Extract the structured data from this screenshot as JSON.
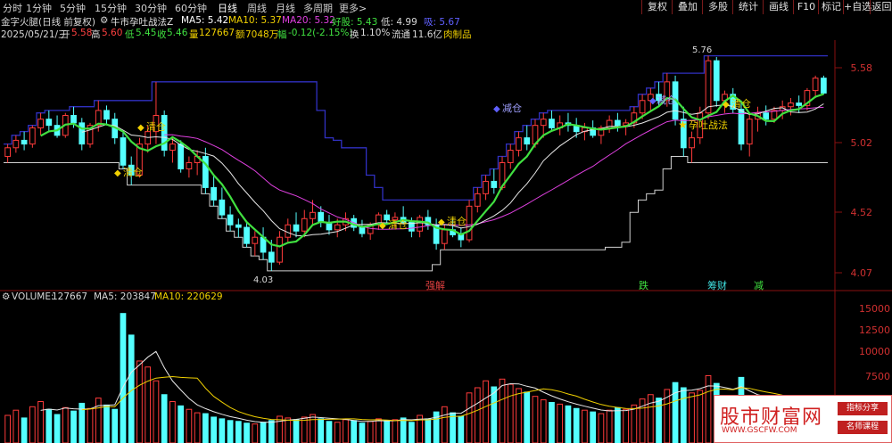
{
  "toolbar": {
    "periods": [
      "分时",
      "1分钟",
      "5分钟",
      "15分钟",
      "30分钟",
      "60分钟",
      "日线",
      "周线",
      "月线",
      "多周期",
      "更多>"
    ],
    "active_period": "日线",
    "buttons": [
      "复权",
      "叠加",
      "多股",
      "统计",
      "画线",
      "F10",
      "标记",
      "+自选",
      "返回"
    ]
  },
  "info": {
    "name": "金字火腿(日线 前复权)",
    "indicator": "牛市孕吐战法Z",
    "ma5": "MA5: 5.42",
    "ma10": "MA10: 5.37",
    "ma20": "MA20: 5.32",
    "haogu": "好股: 5.43",
    "di": "低: 4.99",
    "extra": "吸: 5.67",
    "date": "2025/05/21/三",
    "open_label": "开",
    "open": "5.58",
    "high_label": "高",
    "high": "5.60",
    "low_label": "低",
    "low": "5.45",
    "close_label": "收",
    "close": "5.46",
    "vol_label": "量",
    "vol": "127667",
    "amount_label": "额",
    "amount": "7048万",
    "change_label": "幅",
    "change": "-0.12(-2.15%)",
    "turnover_label": "换",
    "turnover": "1.10%",
    "float_label": "流通",
    "float": "11.6亿",
    "sector": "肉制品"
  },
  "price_axis": [
    "5.58",
    "5.02",
    "4.52",
    "4.07"
  ],
  "vol_axis": [
    "15000",
    "12500",
    "10000",
    "7500"
  ],
  "annotations": {
    "high_label": "5.76",
    "low_label": "4.03",
    "signals": [
      "清仓",
      "清仓",
      "清仓",
      "清仓",
      "减仓",
      "减仓",
      "清仓"
    ],
    "combo": "孕吐战法",
    "bottom_tags": [
      "强解",
      "跌",
      "筹财",
      "减"
    ]
  },
  "volume_bar": {
    "label": "VOLUME:",
    "value": "127667",
    "ma5": "MA5: 203847",
    "ma10": "MA10: 220629"
  },
  "watermark": {
    "title": "股市财富网",
    "url": "WWW.GSCFW.COM",
    "tag1": "指标分享",
    "tag2": "名师课程"
  },
  "chart_data": {
    "type": "candlestick",
    "price_ylim": [
      3.9,
      5.85
    ],
    "volume_ylim": [
      0,
      16000
    ],
    "candles": [
      [
        4.95,
        5.05,
        4.9,
        5.02
      ],
      [
        5.02,
        5.12,
        4.98,
        5.08
      ],
      [
        5.08,
        5.15,
        5.0,
        5.05
      ],
      [
        5.05,
        5.2,
        5.02,
        5.18
      ],
      [
        5.18,
        5.3,
        5.12,
        5.25
      ],
      [
        5.25,
        5.32,
        5.15,
        5.2
      ],
      [
        5.2,
        5.28,
        5.1,
        5.12
      ],
      [
        5.12,
        5.3,
        5.1,
        5.28
      ],
      [
        5.28,
        5.35,
        5.18,
        5.22
      ],
      [
        5.22,
        5.26,
        5.0,
        5.05
      ],
      [
        5.05,
        5.22,
        5.02,
        5.2
      ],
      [
        5.2,
        5.4,
        5.15,
        5.32
      ],
      [
        5.32,
        5.36,
        5.2,
        5.25
      ],
      [
        5.25,
        5.3,
        5.05,
        5.1
      ],
      [
        5.1,
        5.15,
        4.85,
        4.88
      ],
      [
        4.88,
        4.95,
        4.72,
        4.8
      ],
      [
        4.8,
        5.1,
        4.78,
        5.05
      ],
      [
        5.05,
        5.2,
        4.98,
        5.15
      ],
      [
        5.15,
        5.55,
        5.05,
        5.28
      ],
      [
        5.28,
        5.32,
        4.95,
        5.0
      ],
      [
        5.0,
        5.1,
        4.9,
        5.05
      ],
      [
        5.05,
        5.08,
        4.82,
        4.85
      ],
      [
        4.85,
        4.95,
        4.78,
        4.9
      ],
      [
        4.9,
        5.0,
        4.8,
        4.95
      ],
      [
        4.95,
        5.02,
        4.65,
        4.7
      ],
      [
        4.7,
        4.8,
        4.55,
        4.6
      ],
      [
        4.6,
        4.7,
        4.45,
        4.48
      ],
      [
        4.48,
        4.55,
        4.35,
        4.4
      ],
      [
        4.4,
        4.45,
        4.3,
        4.38
      ],
      [
        4.38,
        4.42,
        4.22,
        4.25
      ],
      [
        4.25,
        4.35,
        4.15,
        4.3
      ],
      [
        4.3,
        4.38,
        4.12,
        4.18
      ],
      [
        4.18,
        4.28,
        4.03,
        4.1
      ],
      [
        4.1,
        4.35,
        4.08,
        4.3
      ],
      [
        4.3,
        4.45,
        4.25,
        4.4
      ],
      [
        4.4,
        4.5,
        4.3,
        4.35
      ],
      [
        4.35,
        4.52,
        4.3,
        4.45
      ],
      [
        4.45,
        4.6,
        4.4,
        4.5
      ],
      [
        4.5,
        4.55,
        4.38,
        4.42
      ],
      [
        4.42,
        4.48,
        4.32,
        4.36
      ],
      [
        4.36,
        4.45,
        4.3,
        4.4
      ],
      [
        4.4,
        4.5,
        4.35,
        4.45
      ],
      [
        4.45,
        4.48,
        4.35,
        4.38
      ],
      [
        4.38,
        4.44,
        4.3,
        4.33
      ],
      [
        4.33,
        4.42,
        4.28,
        4.4
      ],
      [
        4.4,
        4.5,
        4.36,
        4.48
      ],
      [
        4.48,
        4.52,
        4.4,
        4.44
      ],
      [
        4.44,
        4.5,
        4.38,
        4.46
      ],
      [
        4.46,
        4.55,
        4.4,
        4.42
      ],
      [
        4.42,
        4.46,
        4.3,
        4.35
      ],
      [
        4.35,
        4.48,
        4.3,
        4.46
      ],
      [
        4.46,
        4.52,
        4.36,
        4.4
      ],
      [
        4.4,
        4.45,
        4.2,
        4.25
      ],
      [
        4.25,
        4.4,
        4.2,
        4.36
      ],
      [
        4.36,
        4.45,
        4.3,
        4.32
      ],
      [
        4.32,
        4.38,
        4.22,
        4.28
      ],
      [
        4.28,
        4.6,
        4.26,
        4.55
      ],
      [
        4.55,
        4.7,
        4.5,
        4.65
      ],
      [
        4.65,
        4.8,
        4.6,
        4.75
      ],
      [
        4.75,
        4.85,
        4.65,
        4.7
      ],
      [
        4.7,
        4.95,
        4.68,
        4.9
      ],
      [
        4.9,
        5.05,
        4.85,
        5.0
      ],
      [
        5.0,
        5.15,
        4.95,
        5.1
      ],
      [
        5.1,
        5.2,
        5.0,
        5.05
      ],
      [
        5.05,
        5.25,
        5.02,
        5.2
      ],
      [
        5.2,
        5.3,
        5.1,
        5.25
      ],
      [
        5.25,
        5.32,
        5.15,
        5.18
      ],
      [
        5.18,
        5.28,
        5.12,
        5.22
      ],
      [
        5.22,
        5.3,
        5.15,
        5.2
      ],
      [
        5.2,
        5.26,
        5.1,
        5.15
      ],
      [
        5.15,
        5.22,
        5.08,
        5.18
      ],
      [
        5.18,
        5.24,
        5.1,
        5.12
      ],
      [
        5.12,
        5.2,
        5.05,
        5.18
      ],
      [
        5.18,
        5.28,
        5.14,
        5.24
      ],
      [
        5.24,
        5.3,
        5.15,
        5.2
      ],
      [
        5.2,
        5.25,
        5.12,
        5.22
      ],
      [
        5.22,
        5.35,
        5.18,
        5.3
      ],
      [
        5.3,
        5.45,
        5.25,
        5.4
      ],
      [
        5.4,
        5.5,
        5.32,
        5.45
      ],
      [
        5.45,
        5.55,
        5.35,
        5.4
      ],
      [
        5.4,
        5.62,
        5.35,
        5.55
      ],
      [
        5.55,
        5.6,
        5.2,
        5.25
      ],
      [
        5.25,
        5.35,
        4.95,
        5.02
      ],
      [
        5.02,
        5.15,
        4.9,
        5.1
      ],
      [
        5.1,
        5.35,
        5.05,
        5.3
      ],
      [
        5.3,
        5.76,
        5.25,
        5.72
      ],
      [
        5.72,
        5.75,
        5.35,
        5.4
      ],
      [
        5.4,
        5.48,
        5.3,
        5.45
      ],
      [
        5.45,
        5.5,
        5.3,
        5.33
      ],
      [
        5.33,
        5.4,
        5.0,
        5.05
      ],
      [
        5.05,
        5.3,
        4.95,
        5.25
      ],
      [
        5.25,
        5.35,
        5.15,
        5.3
      ],
      [
        5.3,
        5.36,
        5.2,
        5.25
      ],
      [
        5.25,
        5.35,
        5.22,
        5.32
      ],
      [
        5.32,
        5.4,
        5.25,
        5.35
      ],
      [
        5.35,
        5.42,
        5.28,
        5.38
      ],
      [
        5.38,
        5.44,
        5.3,
        5.36
      ],
      [
        5.36,
        5.5,
        5.32,
        5.48
      ],
      [
        5.48,
        5.6,
        5.42,
        5.58
      ],
      [
        5.58,
        5.6,
        5.45,
        5.46
      ]
    ],
    "volumes": [
      3200,
      3800,
      2900,
      4200,
      4800,
      3900,
      3300,
      4100,
      3700,
      4600,
      4000,
      5200,
      4400,
      3900,
      15000,
      12500,
      9500,
      8800,
      7200,
      5600,
      4800,
      4300,
      3900,
      3500,
      3400,
      3000,
      2800,
      2600,
      2500,
      2300,
      2200,
      2400,
      2600,
      3100,
      2900,
      2700,
      3000,
      3300,
      2800,
      2500,
      2400,
      2700,
      2600,
      2300,
      2500,
      2800,
      2600,
      2700,
      2900,
      2400,
      3200,
      2800,
      3600,
      4200,
      3500,
      3100,
      5800,
      6400,
      7200,
      6500,
      7400,
      6800,
      6300,
      5900,
      5400,
      5000,
      4700,
      4500,
      4300,
      4000,
      3800,
      3600,
      3400,
      3800,
      4100,
      3900,
      4400,
      5100,
      5600,
      5200,
      6200,
      7000,
      6400,
      5800,
      6100,
      7800,
      6900,
      5500,
      4800,
      7600,
      5400,
      4700,
      4400,
      4200,
      4000,
      3900,
      4100,
      4600,
      4900,
      3600
    ]
  }
}
